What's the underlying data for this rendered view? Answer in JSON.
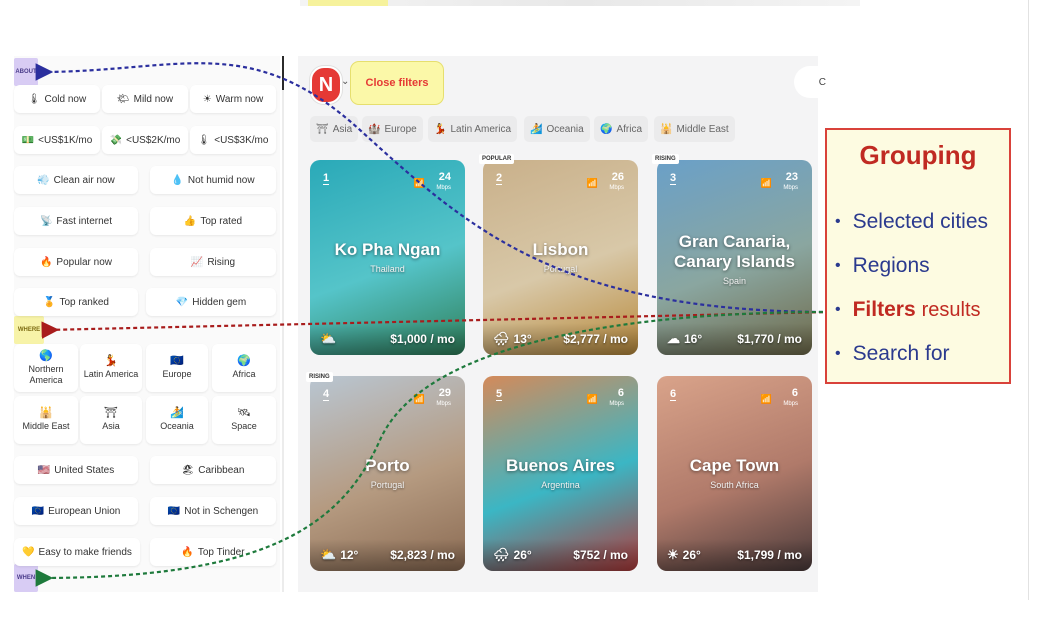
{
  "header_text_blur": "",
  "sidebar": {
    "tags": {
      "about": "ABOUT",
      "where": "WHERE",
      "when": "WHEN"
    },
    "chips": {
      "cold": {
        "icon": "🌡",
        "label": "Cold now"
      },
      "mild": {
        "icon": "🌤",
        "label": "Mild now"
      },
      "warm": {
        "icon": "☀",
        "label": "Warm now"
      },
      "usd1k": {
        "icon": "💵",
        "label": "<US$1K/mo"
      },
      "usd2k": {
        "icon": "💸",
        "label": "<US$2K/mo"
      },
      "usd3k": {
        "icon": "🌡",
        "label": "<US$3K/mo"
      },
      "clean_air": {
        "icon": "💨",
        "label": "Clean air now"
      },
      "not_humid": {
        "icon": "💧",
        "label": "Not humid now"
      },
      "fast_internet": {
        "icon": "📡",
        "label": "Fast internet"
      },
      "top_rated": {
        "icon": "👍",
        "label": "Top rated"
      },
      "popular": {
        "icon": "🔥",
        "label": "Popular now"
      },
      "rising": {
        "icon": "📈",
        "label": "Rising"
      },
      "top_ranked": {
        "icon": "🏅",
        "label": "Top ranked"
      },
      "hidden_gem": {
        "icon": "💎",
        "label": "Hidden gem"
      },
      "us": {
        "icon": "🇺🇸",
        "label": "United States"
      },
      "caribbean": {
        "icon": "🏖",
        "label": "Caribbean"
      },
      "eu": {
        "icon": "🇪🇺",
        "label": "European Union"
      },
      "schengen": {
        "icon": "🇪🇺",
        "label": "Not in Schengen"
      },
      "friends": {
        "icon": "💛",
        "label": "Easy to make friends"
      },
      "tinder": {
        "icon": "🔥",
        "label": "Top Tinder"
      }
    },
    "regions": {
      "n_america": {
        "icon": "🌎",
        "label": "Northern America"
      },
      "latin_america": {
        "icon": "💃",
        "label": "Latin America"
      },
      "europe": {
        "icon": "🇪🇺",
        "label": "Europe"
      },
      "africa": {
        "icon": "🌍",
        "label": "Africa"
      },
      "middle_east": {
        "icon": "🕌",
        "label": "Middle East"
      },
      "asia": {
        "icon": "⛩",
        "label": "Asia"
      },
      "oceania": {
        "icon": "🏄",
        "label": "Oceania"
      },
      "space": {
        "icon": "🛰",
        "label": "Space"
      }
    }
  },
  "topbar": {
    "logo_letter": "N",
    "close_filters": "Close filters",
    "search_fragment": "C"
  },
  "region_tabs": [
    {
      "icon": "⛩",
      "label": "Asia"
    },
    {
      "icon": "🏰",
      "label": "Europe"
    },
    {
      "icon": "💃",
      "label": "Latin America"
    },
    {
      "icon": "🏄",
      "label": "Oceania"
    },
    {
      "icon": "🌍",
      "label": "Africa"
    },
    {
      "icon": "🕌",
      "label": "Middle East"
    }
  ],
  "cards": [
    {
      "rank": "1",
      "net": "24",
      "net_unit": "Mbps",
      "city": "Ko Pha Ngan",
      "country": "Thailand",
      "temp": "",
      "price": "$1,000 / mo",
      "tag": "",
      "weather": "⛅",
      "colors": [
        "#2aa9b8",
        "#55c4c9",
        "#2f7f59"
      ]
    },
    {
      "rank": "2",
      "net": "26",
      "net_unit": "Mbps",
      "city": "Lisbon",
      "country": "Portugal",
      "temp": "13°",
      "price": "$2,777 / mo",
      "tag": "POPULAR",
      "weather": "🌧",
      "colors": [
        "#c9b08a",
        "#d8c8a8",
        "#b88a3c"
      ]
    },
    {
      "rank": "3",
      "net": "23",
      "net_unit": "Mbps",
      "city": "Gran Canaria, Canary Islands",
      "country": "Spain",
      "temp": "16°",
      "price": "$1,770 / mo",
      "tag": "RISING",
      "weather": "☁",
      "colors": [
        "#6aa0c8",
        "#8aa6a0",
        "#6f6a4a"
      ]
    },
    {
      "rank": "4",
      "net": "29",
      "net_unit": "Mbps",
      "city": "Porto",
      "country": "Portugal",
      "temp": "12°",
      "price": "$2,823 / mo",
      "tag": "RISING",
      "weather": "⛅",
      "colors": [
        "#b9c6d2",
        "#b59a80",
        "#8a6a52"
      ]
    },
    {
      "rank": "5",
      "net": "6",
      "net_unit": "Mbps",
      "city": "Buenos Aires",
      "country": "Argentina",
      "temp": "26°",
      "price": "$752 / mo",
      "tag": "",
      "weather": "🌧",
      "colors": [
        "#d48a5a",
        "#3bb6c4",
        "#b03a3a"
      ]
    },
    {
      "rank": "6",
      "net": "6",
      "net_unit": "Mbps",
      "city": "Cape Town",
      "country": "South Africa",
      "temp": "26°",
      "price": "$1,799 / mo",
      "tag": "",
      "weather": "☀",
      "colors": [
        "#d9a38a",
        "#b07a6a",
        "#4a3a3a"
      ]
    }
  ],
  "callout": {
    "title": "Grouping",
    "items": [
      {
        "text": "Selected cities",
        "strong": "",
        "tail": ""
      },
      {
        "text": "Regions",
        "strong": "",
        "tail": ""
      },
      {
        "text": "",
        "strong": "Filters",
        "tail": "results"
      },
      {
        "text": "Search for",
        "strong": "",
        "tail": ""
      }
    ]
  },
  "colors": {
    "arrow_blue": "#2b2f9e",
    "arrow_red": "#a81c1c",
    "arrow_green": "#1e7a3c",
    "accent_red": "#e53935",
    "highlight_yellow": "#fbf8a8"
  }
}
